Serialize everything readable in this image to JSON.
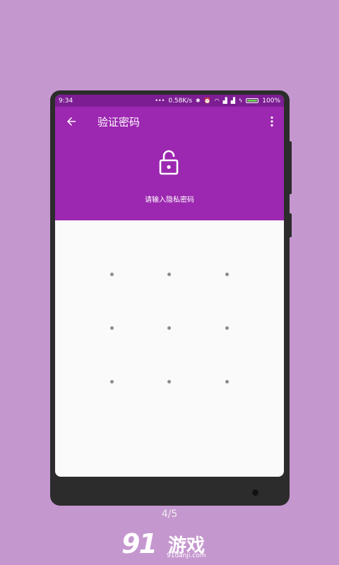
{
  "status_bar": {
    "time": "9:34",
    "network_speed": "0.58K/s",
    "battery_percent": "100%",
    "icons": [
      "more-dots-icon",
      "bluetooth-icon",
      "alarm-icon",
      "wifi-icon",
      "signal-icon",
      "signal-icon",
      "charging-icon",
      "battery-icon"
    ]
  },
  "toolbar": {
    "title": "验证密码",
    "back_icon": "arrow-left-icon",
    "menu_icon": "more-vert-icon"
  },
  "header": {
    "lock_icon": "unlock-icon",
    "prompt": "请输入隐私密码"
  },
  "pattern_grid": {
    "rows": 3,
    "cols": 3
  },
  "colors": {
    "background": "#c597cf",
    "accent": "#9c27b0",
    "status_bar": "#7c1d93",
    "screen_bg": "#fafafa",
    "dot": "#8c8c8c"
  },
  "pager": "4/5",
  "watermark": {
    "number": "9",
    "number2": "1",
    "text": "游戏",
    "sub": "91danji.com"
  }
}
